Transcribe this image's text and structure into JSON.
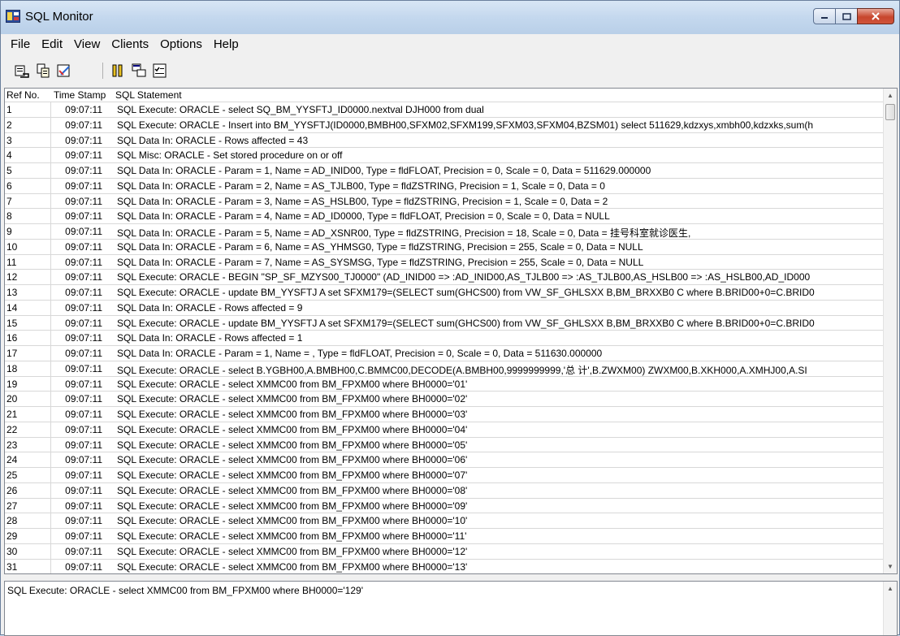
{
  "window": {
    "title": "SQL Monitor"
  },
  "menu": [
    "File",
    "Edit",
    "View",
    "Clients",
    "Options",
    "Help"
  ],
  "toolbar": [
    "save-log-icon",
    "copy-icon",
    "clear-icon",
    "pause-icon",
    "clients-icon",
    "trace-options-icon"
  ],
  "columns": {
    "ref": "Ref No.",
    "time": "Time Stamp",
    "sql": "SQL Statement"
  },
  "rows": [
    {
      "ref": "1",
      "time": "09:07:11",
      "sql": "SQL Execute: ORACLE -  select  SQ_BM_YYSFTJ_ID0000.nextval  DJH000   from dual"
    },
    {
      "ref": "2",
      "time": "09:07:11",
      "sql": "SQL Execute: ORACLE - Insert into  BM_YYSFTJ(ID0000,BMBH00,SFXM02,SFXM199,SFXM03,SFXM04,BZSM01) select 511629,kdzxys,xmbh00,kdzxks,sum(h"
    },
    {
      "ref": "3",
      "time": "09:07:11",
      "sql": "SQL Data In: ORACLE - Rows affected = 43"
    },
    {
      "ref": "4",
      "time": "09:07:11",
      "sql": "SQL Misc: ORACLE - Set stored procedure on or off"
    },
    {
      "ref": "5",
      "time": "09:07:11",
      "sql": "SQL Data In: ORACLE - Param = 1, Name = AD_INID00, Type = fldFLOAT, Precision = 0, Scale = 0, Data = 511629.000000"
    },
    {
      "ref": "6",
      "time": "09:07:11",
      "sql": "SQL Data In: ORACLE - Param = 2, Name = AS_TJLB00, Type = fldZSTRING, Precision = 1, Scale = 0, Data = 0"
    },
    {
      "ref": "7",
      "time": "09:07:11",
      "sql": "SQL Data In: ORACLE - Param = 3, Name = AS_HSLB00, Type = fldZSTRING, Precision = 1, Scale = 0, Data = 2"
    },
    {
      "ref": "8",
      "time": "09:07:11",
      "sql": "SQL Data In: ORACLE - Param = 4, Name = AD_ID0000, Type = fldFLOAT, Precision = 0, Scale = 0, Data = NULL"
    },
    {
      "ref": "9",
      "time": "09:07:11",
      "sql": "SQL Data In: ORACLE - Param = 5, Name = AD_XSNR00, Type = fldZSTRING, Precision = 18, Scale = 0, Data = 挂号科室就诊医生,"
    },
    {
      "ref": "10",
      "time": "09:07:11",
      "sql": "SQL Data In: ORACLE - Param = 6, Name = AS_YHMSG0, Type = fldZSTRING, Precision = 255, Scale = 0, Data = NULL"
    },
    {
      "ref": "11",
      "time": "09:07:11",
      "sql": "SQL Data In: ORACLE - Param = 7, Name = AS_SYSMSG, Type = fldZSTRING, Precision = 255, Scale = 0, Data = NULL"
    },
    {
      "ref": "12",
      "time": "09:07:11",
      "sql": "SQL Execute: ORACLE - BEGIN \"SP_SF_MZYS00_TJ0000\" (AD_INID00 => :AD_INID00,AS_TJLB00 => :AS_TJLB00,AS_HSLB00 => :AS_HSLB00,AD_ID000"
    },
    {
      "ref": "13",
      "time": "09:07:11",
      "sql": "SQL Execute: ORACLE - update BM_YYSFTJ A set SFXM179=(SELECT sum(GHCS00) from VW_SF_GHLSXX B,BM_BRXXB0 C  where B.BRID00+0=C.BRID0"
    },
    {
      "ref": "14",
      "time": "09:07:11",
      "sql": "SQL Data In: ORACLE - Rows affected = 9"
    },
    {
      "ref": "15",
      "time": "09:07:11",
      "sql": "SQL Execute: ORACLE - update BM_YYSFTJ A set SFXM179=(SELECT sum(GHCS00) from VW_SF_GHLSXX B,BM_BRXXB0 C  where B.BRID00+0=C.BRID0"
    },
    {
      "ref": "16",
      "time": "09:07:11",
      "sql": "SQL Data In: ORACLE - Rows affected = 1"
    },
    {
      "ref": "17",
      "time": "09:07:11",
      "sql": "SQL Data In: ORACLE - Param = 1, Name = , Type = fldFLOAT, Precision = 0, Scale = 0, Data = 511630.000000"
    },
    {
      "ref": "18",
      "time": "09:07:11",
      "sql": "SQL Execute: ORACLE - select B.YGBH00,A.BMBH00,C.BMMC00,DECODE(A.BMBH00,9999999999,'总 计',B.ZWXM00) ZWXM00,B.XKH000,A.XMHJ00,A.SI"
    },
    {
      "ref": "19",
      "time": "09:07:11",
      "sql": "SQL Execute: ORACLE -  select XMMC00  from  BM_FPXM00  where   BH0000='01'"
    },
    {
      "ref": "20",
      "time": "09:07:11",
      "sql": "SQL Execute: ORACLE -  select XMMC00  from  BM_FPXM00  where   BH0000='02'"
    },
    {
      "ref": "21",
      "time": "09:07:11",
      "sql": "SQL Execute: ORACLE -  select XMMC00  from  BM_FPXM00  where   BH0000='03'"
    },
    {
      "ref": "22",
      "time": "09:07:11",
      "sql": "SQL Execute: ORACLE -  select XMMC00  from  BM_FPXM00  where   BH0000='04'"
    },
    {
      "ref": "23",
      "time": "09:07:11",
      "sql": "SQL Execute: ORACLE -  select XMMC00  from  BM_FPXM00  where   BH0000='05'"
    },
    {
      "ref": "24",
      "time": "09:07:11",
      "sql": "SQL Execute: ORACLE -  select XMMC00  from  BM_FPXM00  where   BH0000='06'"
    },
    {
      "ref": "25",
      "time": "09:07:11",
      "sql": "SQL Execute: ORACLE -  select XMMC00  from  BM_FPXM00  where   BH0000='07'"
    },
    {
      "ref": "26",
      "time": "09:07:11",
      "sql": "SQL Execute: ORACLE -  select XMMC00  from  BM_FPXM00  where   BH0000='08'"
    },
    {
      "ref": "27",
      "time": "09:07:11",
      "sql": "SQL Execute: ORACLE -  select XMMC00  from  BM_FPXM00  where   BH0000='09'"
    },
    {
      "ref": "28",
      "time": "09:07:11",
      "sql": "SQL Execute: ORACLE -  select XMMC00  from  BM_FPXM00  where   BH0000='10'"
    },
    {
      "ref": "29",
      "time": "09:07:11",
      "sql": "SQL Execute: ORACLE -  select XMMC00  from  BM_FPXM00  where   BH0000='11'"
    },
    {
      "ref": "30",
      "time": "09:07:11",
      "sql": "SQL Execute: ORACLE -  select XMMC00  from  BM_FPXM00  where   BH0000='12'"
    },
    {
      "ref": "31",
      "time": "09:07:11",
      "sql": "SQL Execute: ORACLE -  select XMMC00  from  BM_FPXM00  where   BH0000='13'"
    }
  ],
  "detail": {
    "text": "SQL Execute: ORACLE -  select XMMC00  from  BM_FPXM00  where   BH0000='129'"
  }
}
